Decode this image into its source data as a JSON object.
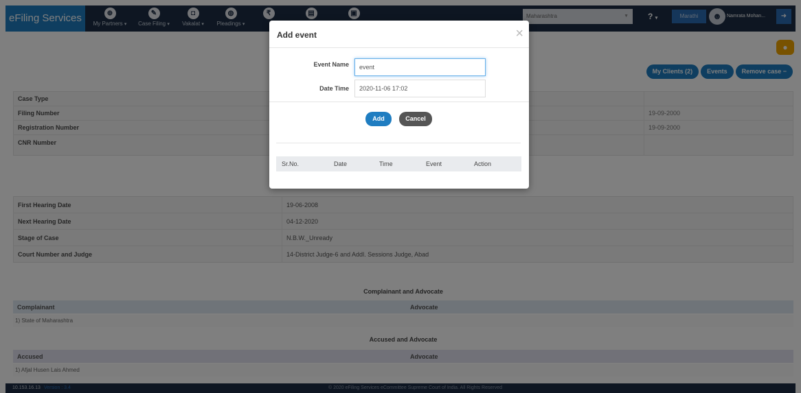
{
  "navbar": {
    "brand": "eFiling Services",
    "items": [
      {
        "label": "My Partners",
        "icon": "partners-icon",
        "glyph": "⊕"
      },
      {
        "label": "Case Filing",
        "icon": "pencil-icon",
        "glyph": "✎"
      },
      {
        "label": "Vakalat",
        "icon": "vakalat-icon",
        "glyph": "◘"
      },
      {
        "label": "Pleadings",
        "icon": "pleadings-icon",
        "glyph": "◍"
      },
      {
        "label": "",
        "icon": "rupee-icon",
        "glyph": "₹"
      },
      {
        "label": "",
        "icon": "document-icon",
        "glyph": "▤"
      },
      {
        "label": "",
        "icon": "briefcase-icon",
        "glyph": "▣"
      }
    ],
    "state_select": "Maharashtra",
    "help": "?",
    "language": "Marathi",
    "user_name": "Namrata Mohan..."
  },
  "top_buttons": {
    "my_clients": "My Clients (2)",
    "events": "Events",
    "remove_case": "Remove case"
  },
  "case_details": [
    {
      "label": "Case Type",
      "value": "",
      "right": ""
    },
    {
      "label": "Filing Number",
      "value": "",
      "right": "19-09-2000"
    },
    {
      "label": "Registration Number",
      "value": "",
      "right": "19-09-2000"
    },
    {
      "label": "CNR Number",
      "value": "",
      "right": ""
    }
  ],
  "hearing_details": [
    {
      "label": "First Hearing Date",
      "value": "19-06-2008"
    },
    {
      "label": "Next Hearing Date",
      "value": "04-12-2020"
    },
    {
      "label": "Stage of Case",
      "value": "N.B.W._Unready"
    },
    {
      "label": "Court Number and Judge",
      "value": "14-District Judge-6 and Addl. Sessions Judge, Abad"
    }
  ],
  "complainant": {
    "section_title": "Complainant and Advocate",
    "col1": "Complainant",
    "col2": "Advocate",
    "row": "1) State of Maharashtra"
  },
  "accused": {
    "section_title": "Accused and Advocate",
    "col1": "Accused",
    "col2": "Advocate",
    "row": "1) Afjal Husen Lais Ahmed"
  },
  "footer": {
    "ip": "10.153.16.13",
    "version": "Version : 3.4",
    "copyright": "© 2020 eFiling Services eCommittee Supreme Court of India. All Rights Reserved"
  },
  "modal": {
    "title": "Add event",
    "close": "×",
    "event_name_label": "Event Name",
    "event_name_value": "event",
    "date_time_label": "Date Time",
    "date_time_value": "2020-11-06 17:02",
    "add_button": "Add",
    "cancel_button": "Cancel",
    "table_headers": [
      "Sr.No.",
      "Date",
      "Time",
      "Event",
      "Action"
    ]
  }
}
